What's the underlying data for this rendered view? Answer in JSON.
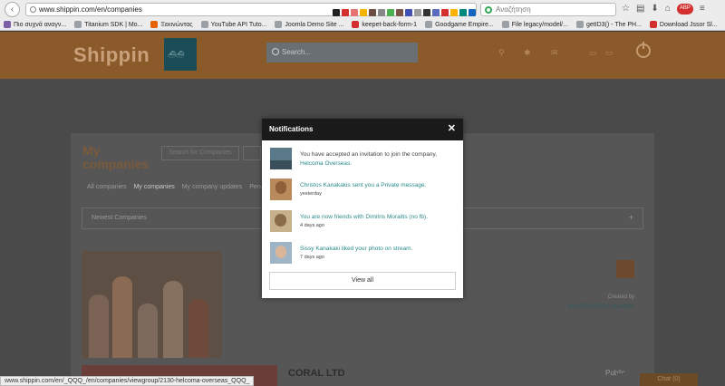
{
  "browser": {
    "url": "www.shippin.com/en/companies",
    "search_placeholder": "Αναζήτηση",
    "bookmarks": [
      {
        "label": "Πιο συχνά αναγν...",
        "color": "#7b5ea7"
      },
      {
        "label": "Titanium SDK | Mo...",
        "color": "#9aa0a6"
      },
      {
        "label": "Ξεκινώντας",
        "color": "#e66000"
      },
      {
        "label": "YouTube API Tuto...",
        "color": "#9aa0a6"
      },
      {
        "label": "Joomla Demo Site ...",
        "color": "#9aa0a6"
      },
      {
        "label": "keepet-back-form-1",
        "color": "#d32f2f"
      },
      {
        "label": "Goodgame Empire...",
        "color": "#9aa0a6"
      },
      {
        "label": "File legacy/model/...",
        "color": "#9aa0a6"
      },
      {
        "label": "getID3() - The PH...",
        "color": "#9aa0a6"
      },
      {
        "label": "Download Jssor Sl...",
        "color": "#d32f2f"
      }
    ],
    "status_url": "www.shippin.com/en/_QQQ_/en/companies/viewgroup/2130-helcoma-overseas_QQQ_"
  },
  "site": {
    "brand": "Shippin",
    "search_placeholder": "Search...",
    "panel": {
      "title": "My companies",
      "search_placeholder": "Search for Companies",
      "tabs": [
        {
          "label": "All companies",
          "active": false
        },
        {
          "label": "My companies",
          "active": true
        },
        {
          "label": "My company updates",
          "active": false
        },
        {
          "label": "Pen...",
          "active": false
        }
      ],
      "sort_label": "Newest Companies",
      "created_by_label": "Created by",
      "creator_name": "KONSTANTINOS VLASSIS",
      "public_label": "Public",
      "second_company": "CORAL LTD",
      "chat_label": "Chat (0)"
    }
  },
  "modal": {
    "title": "Notifications",
    "close_glyph": "✕",
    "items": [
      {
        "text": "You have accepted an invitation to join the company,",
        "link": "Helcoma Overseas.",
        "time": ""
      },
      {
        "text": "",
        "link": "Christos Kanakakis sent you a Private message.",
        "time": "yesterday"
      },
      {
        "text": "",
        "link": "You are now friends with Dimitris Moraitis (no fb).",
        "time": "4 days ago"
      },
      {
        "text": "",
        "link": "Sissy Kanakaki liked your photo on stream.",
        "time": "7 days ago"
      }
    ],
    "view_all_label": "View all"
  }
}
